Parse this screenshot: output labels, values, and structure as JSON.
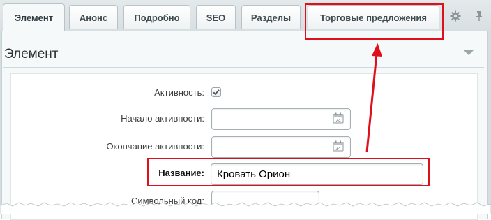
{
  "tabs": [
    {
      "label": "Элемент",
      "active": true
    },
    {
      "label": "Анонс",
      "active": false
    },
    {
      "label": "Подробно",
      "active": false
    },
    {
      "label": "SEO",
      "active": false
    },
    {
      "label": "Разделы",
      "active": false
    },
    {
      "label": "Торговые предложения",
      "active": false,
      "highlighted": true
    }
  ],
  "toolbar": {
    "settings_icon": "gear-icon",
    "pin_icon": "pin-icon"
  },
  "section": {
    "title": "Элемент",
    "collapse_icon": "triangle-down-icon"
  },
  "form": {
    "active": {
      "label": "Активность:",
      "checked": true
    },
    "start": {
      "label": "Начало активности:",
      "value": "",
      "icon": "calendar-icon"
    },
    "end": {
      "label": "Окончание активности:",
      "value": "",
      "icon": "calendar-icon"
    },
    "name": {
      "label": "Название:",
      "value": "Кровать Орион",
      "highlighted": true
    },
    "code": {
      "label": "Символьный код:",
      "value": ""
    }
  },
  "annotation": {
    "color": "#e0101a",
    "arrow": "from name field to offers tab"
  }
}
